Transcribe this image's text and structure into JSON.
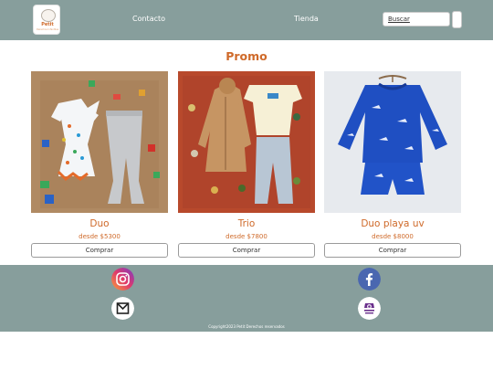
{
  "header": {
    "logo": {
      "brand": "Petit",
      "tagline": "Derechos Infantiles"
    },
    "nav": [
      {
        "label": "Contacto"
      },
      {
        "label": "Tienda"
      }
    ],
    "search": {
      "label": "Buscar"
    }
  },
  "promo": {
    "title": "Promo",
    "products": [
      {
        "name": "Duo",
        "price": "desde $5300",
        "button": "Comprar"
      },
      {
        "name": "Trio",
        "price": "desde $7800",
        "button": "Comprar"
      },
      {
        "name": "Duo playa uv",
        "price": "desde $8000",
        "button": "Comprar"
      }
    ]
  },
  "footer": {
    "social": [
      {
        "icon": "instagram-icon"
      },
      {
        "icon": "facebook-icon"
      },
      {
        "icon": "mail-icon"
      },
      {
        "icon": "mercadoshops-icon"
      }
    ],
    "copyright": "Copyright2023 Petit Derechos reservados"
  },
  "colors": {
    "header": "#879e9c",
    "accent": "#cf6a2a",
    "footer": "#879e9c"
  }
}
